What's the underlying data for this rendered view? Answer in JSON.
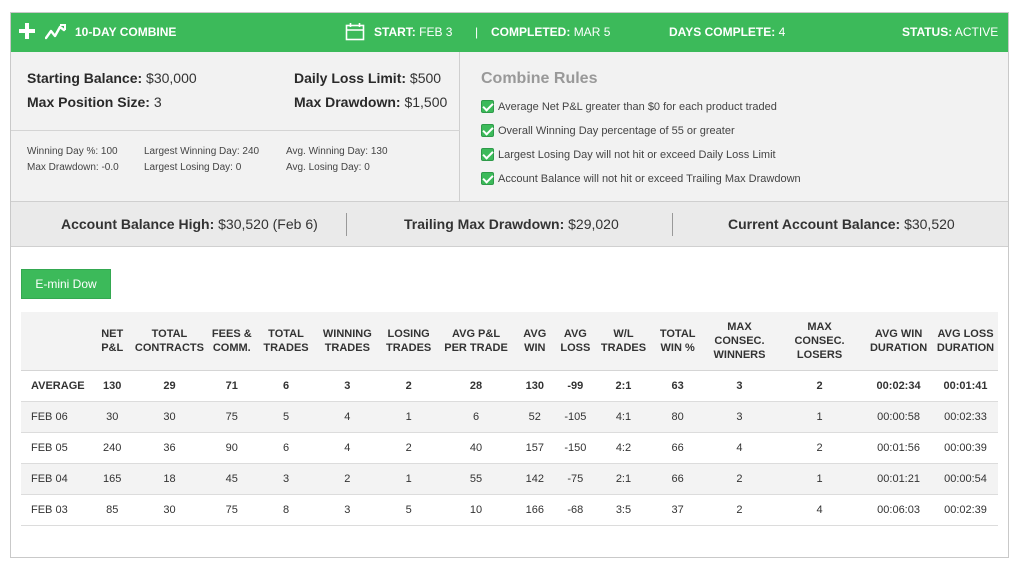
{
  "header": {
    "title": "10-DAY COMBINE",
    "start_label": "START:",
    "start_value": "FEB 3",
    "completed_label": "COMPLETED:",
    "completed_value": "MAR 5",
    "days_label": "DAYS COMPLETE:",
    "days_value": "4",
    "status_label": "STATUS:",
    "status_value": "ACTIVE",
    "bar_color": "#3cba5a"
  },
  "summary": {
    "starting_balance_label": "Starting Balance:",
    "starting_balance": "$30,000",
    "max_position_label": "Max Position Size:",
    "max_position": "3",
    "daily_loss_label": "Daily Loss Limit:",
    "daily_loss": "$500",
    "max_drawdown_label": "Max Drawdown:",
    "max_drawdown": "$1,500",
    "stats": {
      "winning_day_pct": "Winning Day %: 100",
      "max_drawdown": "Max Drawdown: -0.0",
      "largest_winning_day": "Largest Winning Day: 240",
      "largest_losing_day": "Largest Losing Day: 0",
      "avg_winning_day": "Avg. Winning Day: 130",
      "avg_losing_day": "Avg. Losing Day: 0"
    }
  },
  "rules": {
    "title": "Combine Rules",
    "items": [
      "Average Net P&L greater than $0 for each product traded",
      "Overall Winning Day percentage of 55 or greater",
      "Largest Losing Day will not hit or exceed Daily Loss Limit",
      "Account Balance will not hit or exceed Trailing Max Drawdown"
    ]
  },
  "balances": {
    "high_label": "Account Balance High:",
    "high_value": "$30,520 (Feb 6)",
    "trailing_label": "Trailing Max Drawdown:",
    "trailing_value": "$29,020",
    "current_label": "Current Account Balance:",
    "current_value": "$30,520"
  },
  "product": {
    "label": "E-mini Dow"
  },
  "table": {
    "columns": [
      [
        "",
        ""
      ],
      [
        "NET",
        "P&L"
      ],
      [
        "TOTAL",
        "CONTRACTS"
      ],
      [
        "FEES &",
        "COMM."
      ],
      [
        "TOTAL",
        "TRADES"
      ],
      [
        "WINNING",
        "TRADES"
      ],
      [
        "LOSING",
        "TRADES"
      ],
      [
        "AVG P&L",
        "PER TRADE"
      ],
      [
        "AVG",
        "WIN"
      ],
      [
        "AVG",
        "LOSS"
      ],
      [
        "W/L",
        "TRADES"
      ],
      [
        "TOTAL",
        "WIN %"
      ],
      [
        "MAX",
        "CONSEC.",
        "WINNERS"
      ],
      [
        "MAX",
        "CONSEC.",
        "LOSERS"
      ],
      [
        "AVG WIN",
        "DURATION"
      ],
      [
        "AVG LOSS",
        "DURATION"
      ]
    ],
    "rows": [
      [
        "AVERAGE",
        "130",
        "29",
        "71",
        "6",
        "3",
        "2",
        "28",
        "130",
        "-99",
        "2:1",
        "63",
        "3",
        "2",
        "00:02:34",
        "00:01:41"
      ],
      [
        "FEB 06",
        "30",
        "30",
        "75",
        "5",
        "4",
        "1",
        "6",
        "52",
        "-105",
        "4:1",
        "80",
        "3",
        "1",
        "00:00:58",
        "00:02:33"
      ],
      [
        "FEB 05",
        "240",
        "36",
        "90",
        "6",
        "4",
        "2",
        "40",
        "157",
        "-150",
        "4:2",
        "66",
        "4",
        "2",
        "00:01:56",
        "00:00:39"
      ],
      [
        "FEB 04",
        "165",
        "18",
        "45",
        "3",
        "2",
        "1",
        "55",
        "142",
        "-75",
        "2:1",
        "66",
        "2",
        "1",
        "00:01:21",
        "00:00:54"
      ],
      [
        "FEB 03",
        "85",
        "30",
        "75",
        "8",
        "3",
        "5",
        "10",
        "166",
        "-68",
        "3:5",
        "37",
        "2",
        "4",
        "00:06:03",
        "00:02:39"
      ]
    ]
  }
}
